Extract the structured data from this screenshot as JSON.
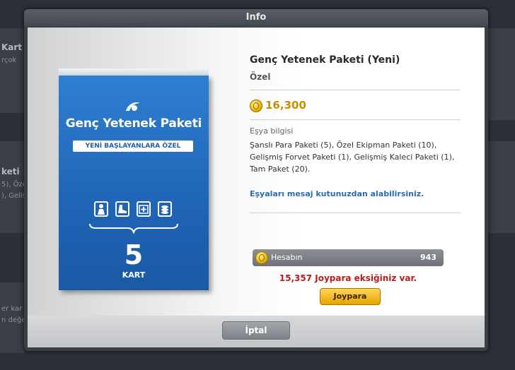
{
  "background": {
    "left_items": [
      "Kart",
      "rçok",
      "keti",
      "5), Öze",
      "), Geliş",
      "er kar",
      "n değe"
    ]
  },
  "dialog": {
    "title": "Info",
    "package": {
      "title": "Genç Yetenek Paketi",
      "badge": "YENİ BAŞLAYANLARA ÖZEL",
      "count": "5",
      "count_label": "KART",
      "icons": [
        "player-icon",
        "boot-icon",
        "medkit-icon",
        "stack-icon"
      ]
    },
    "item": {
      "title": "Genç Yetenek Paketi (Yeni)",
      "subtitle": "Özel",
      "price": "16,300",
      "info_label": "Eşya bilgisi",
      "info_text": "Şanslı Para Paketi (5), Özel Ekipman Paketi (10), Gelişmiş Forvet Paketi (1), Gelişmiş Kaleci Paketi (1), Tam Paket (20).",
      "note": "Eşyaları mesaj kutunuzdan alabilirsiniz."
    },
    "account": {
      "label": "Hesabın",
      "balance": "943",
      "shortage_text": "15,357 Joypara eksiğiniz var.",
      "button_label": "Joypara"
    },
    "cancel_label": "İptal"
  },
  "colors": {
    "accent_gold": "#c98e00",
    "shortage_red": "#b81d1d",
    "note_blue": "#2b6cb0",
    "package_blue": "#1f64b6"
  }
}
